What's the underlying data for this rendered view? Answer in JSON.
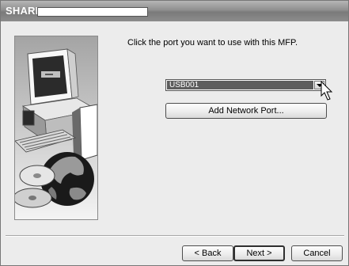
{
  "window": {
    "brand": "SHARP"
  },
  "content": {
    "instruction": "Click the port you want to use with this MFP."
  },
  "port_select": {
    "value": "USB001",
    "dropdown_icon": "chevron-down-icon"
  },
  "buttons": {
    "add_network_port": "Add Network Port...",
    "back": "< Back",
    "next": "Next >",
    "cancel": "Cancel"
  },
  "illustration": {
    "description_icons": [
      "computer-icon",
      "globe-icon",
      "disc-icon"
    ]
  },
  "colors": {
    "titlebar": "#8f8f8f",
    "selection": "#5d5d5d",
    "background": "#ececec"
  }
}
